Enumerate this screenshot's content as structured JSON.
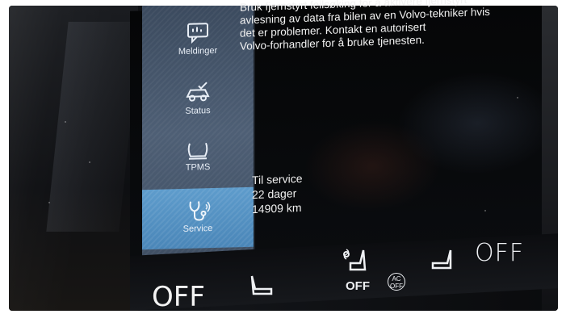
{
  "sidebar": {
    "items": [
      {
        "label": "Meldinger",
        "icon": "message-icon",
        "active": false
      },
      {
        "label": "Status",
        "icon": "car-status-icon",
        "active": false
      },
      {
        "label": "TPMS",
        "icon": "tire-pressure-icon",
        "active": false
      },
      {
        "label": "Service",
        "icon": "wrench-stethoscope-icon",
        "active": true
      }
    ]
  },
  "info": {
    "line1": "Bruk fjernstyrt feilsøking for å aktivere fjernstyrt",
    "line2": "avlesning av data fra bilen av en Volvo-tekniker hvis",
    "line3": "det er problemer. Kontakt en autorisert",
    "line4": "Volvo-forhandler for å bruke tjenesten."
  },
  "service": {
    "title": "Til service",
    "days": "22 dager",
    "km": "14909 km"
  },
  "controls": {
    "left_off": "OFF",
    "fan_off": "OFF",
    "ac_label": "AC",
    "ac_off": "OFF",
    "right_off": "OFF"
  },
  "colors": {
    "sidebar": "#4e5f75",
    "active_item": "#4a86b8",
    "text": "#f2f2f2"
  }
}
